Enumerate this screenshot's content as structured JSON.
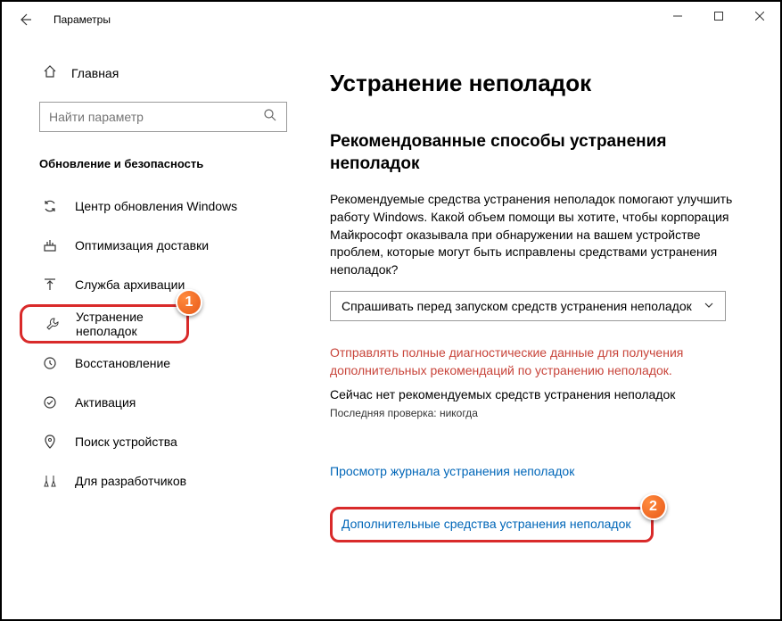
{
  "titlebar": {
    "title": "Параметры"
  },
  "sidebar": {
    "home": "Главная",
    "search_placeholder": "Найти параметр",
    "section_header": "Обновление и безопасность",
    "items": [
      {
        "label": "Центр обновления Windows"
      },
      {
        "label": "Оптимизация доставки"
      },
      {
        "label": "Служба архивации"
      },
      {
        "label": "Устранение неполадок"
      },
      {
        "label": "Восстановление"
      },
      {
        "label": "Активация"
      },
      {
        "label": "Поиск устройства"
      },
      {
        "label": "Для разработчиков"
      }
    ]
  },
  "main": {
    "title": "Устранение неполадок",
    "subheading": "Рекомендованные способы устранения неполадок",
    "body": "Рекомендуемые средства устранения неполадок помогают улучшить работу Windows. Какой объем помощи вы хотите, чтобы корпорация Майкрософт оказывала при обнаружении на вашем устройстве проблем, которые могут быть исправлены средствами устранения неполадок?",
    "dropdown_value": "Спрашивать перед запуском средств устранения неполадок",
    "warning": "Отправлять полные диагностические данные для получения дополнительных рекомендаций по устранению неполадок.",
    "no_rec": "Сейчас нет рекомендуемых средств устранения неполадок",
    "last_check": "Последняя проверка: никогда",
    "link_history": "Просмотр журнала устранения неполадок",
    "link_additional": "Дополнительные средства устранения неполадок"
  },
  "badges": {
    "one": "1",
    "two": "2"
  }
}
